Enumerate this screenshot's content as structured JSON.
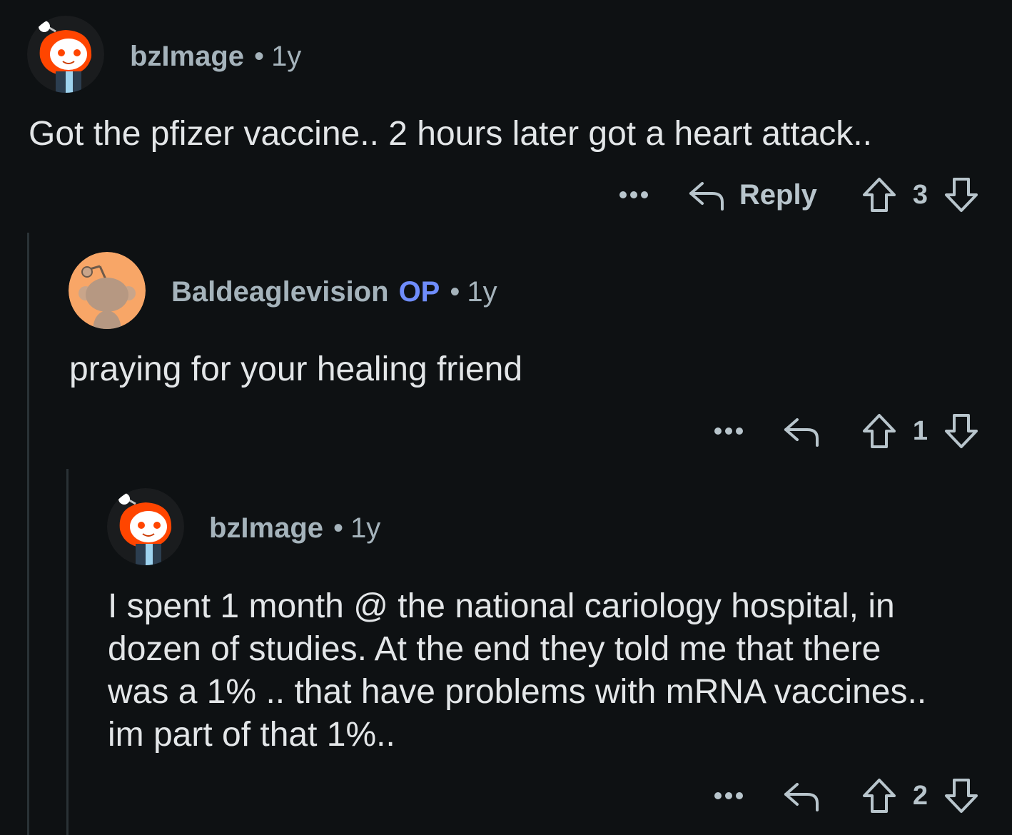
{
  "comments": [
    {
      "author": "bzImage",
      "op_badge": "",
      "age": "1y",
      "avatar": "snoo-red-hood-icon",
      "body": "Got the pfizer vaccine.. 2 hours later got a heart attack..",
      "reply_label": "Reply",
      "score": "3"
    },
    {
      "author": "Baldeaglevision",
      "op_badge": "OP",
      "age": "1y",
      "avatar": "snoo-default-orange-icon",
      "body": "praying for your healing friend",
      "reply_label": "",
      "score": "1"
    },
    {
      "author": "bzImage",
      "op_badge": "",
      "age": "1y",
      "avatar": "snoo-red-hood-icon",
      "body_lines": [
        "I spent 1 month @ the national cariology hospital, in",
        "dozen of studies. At the end they told me that there",
        "was a 1% .. that have problems with mRNA vaccines..",
        "im part of that 1%.."
      ],
      "reply_label": "",
      "score": "2"
    }
  ],
  "colors": {
    "background": "#0e1113",
    "username": "#a5b3bb",
    "op_badge": "#6f8dfc",
    "body_text": "#e3e6e8",
    "thread_line": "#2a3236"
  }
}
